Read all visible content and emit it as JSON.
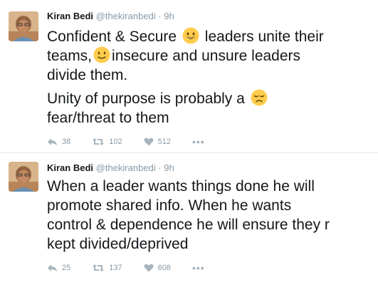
{
  "tweets": [
    {
      "author_name": "Kiran Bedi",
      "handle": "@thekiranbedi",
      "separator": "·",
      "time": "9h",
      "lines": [
        "Confident & Secure",
        "leaders unite their",
        "teams,",
        "insecure and unsure leaders",
        "divide them.",
        "Unity of purpose is probably a",
        "fear/threat to them"
      ],
      "emojis": [
        "smiling-face-emoji",
        "slightly-smiling-face-emoji",
        "disappointed-face-emoji"
      ],
      "reply_count": "38",
      "retweet_count": "102",
      "like_count": "512",
      "more_label": "•••"
    },
    {
      "author_name": "Kiran Bedi",
      "handle": "@thekiranbedi",
      "separator": "·",
      "time": "9h",
      "lines": [
        "When a leader wants things done he will",
        "promote shared info. When he wants",
        "control & dependence he will ensure they r",
        "kept divided/deprived"
      ],
      "reply_count": "25",
      "retweet_count": "137",
      "like_count": "608",
      "more_label": "•••"
    }
  ],
  "colors": {
    "text": "#14171a",
    "muted": "#8899a6",
    "divider": "#e1e8ed",
    "emoji": "#ffcc4d"
  }
}
